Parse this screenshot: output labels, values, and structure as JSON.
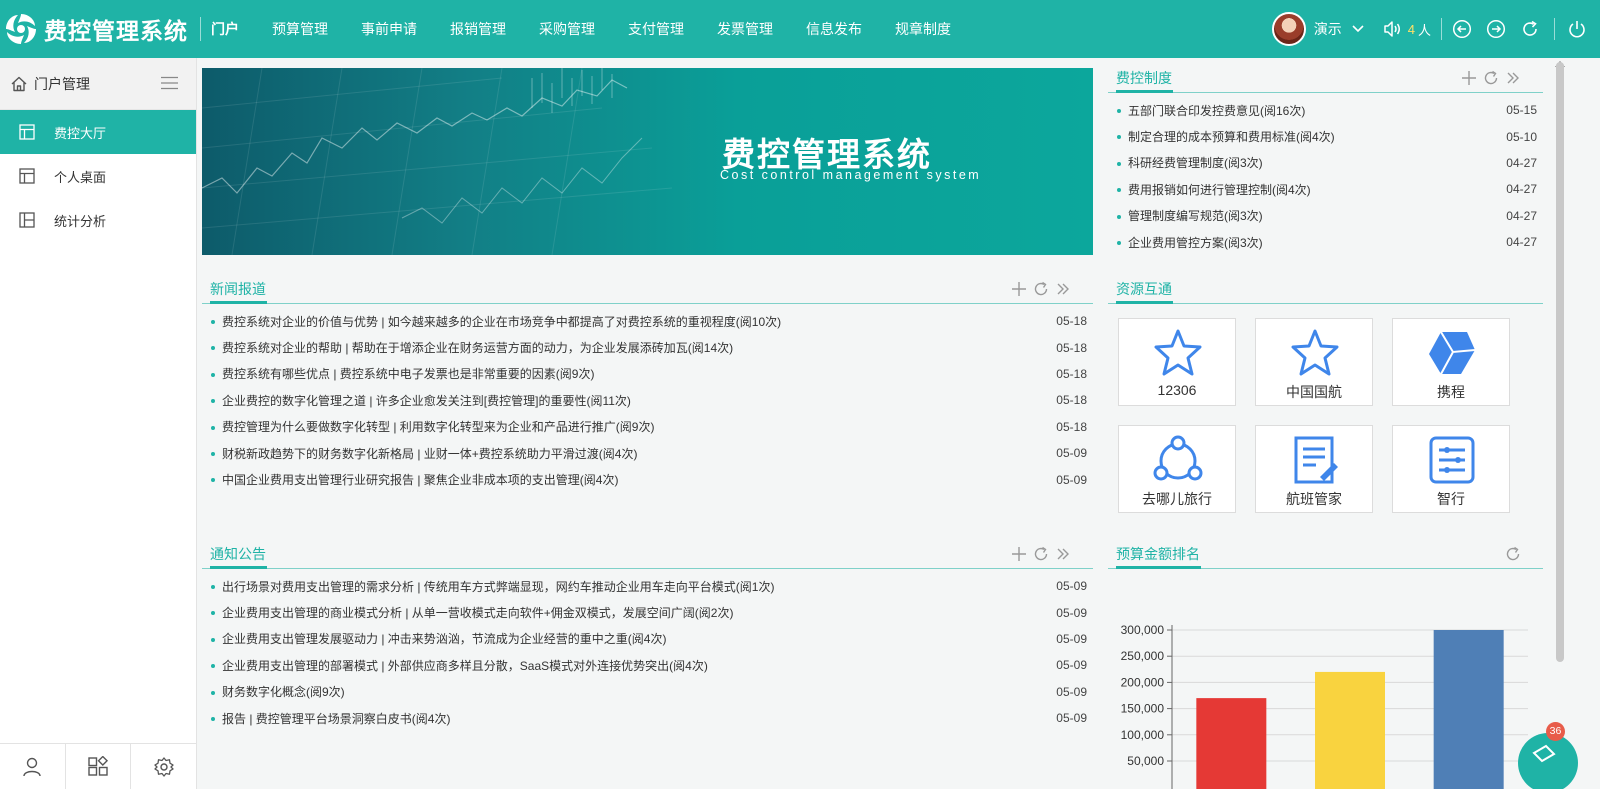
{
  "app": {
    "title": "费控管理系统"
  },
  "topnav": [
    {
      "label": "门户",
      "active": true
    },
    {
      "label": "预算管理"
    },
    {
      "label": "事前申请"
    },
    {
      "label": "报销管理"
    },
    {
      "label": "采购管理"
    },
    {
      "label": "支付管理"
    },
    {
      "label": "发票管理"
    },
    {
      "label": "信息发布"
    },
    {
      "label": "规章制度"
    }
  ],
  "user": {
    "name": "演示",
    "online_count": "4",
    "online_unit": "人"
  },
  "sidebar": {
    "title": "门户管理",
    "items": [
      {
        "label": "费控大厅",
        "active": true
      },
      {
        "label": "个人桌面"
      },
      {
        "label": "统计分析"
      }
    ]
  },
  "banner": {
    "title": "费控管理系统",
    "subtitle": "Cost control management system"
  },
  "news": {
    "title": "新闻报道",
    "items": [
      {
        "text": "费控系统对企业的价值与优势 | 如今越来越多的企业在市场竞争中都提高了对费控系统的重视程度(阅10次)",
        "date": "05-18"
      },
      {
        "text": "费控系统对企业的帮助 | 帮助在于增添企业在财务运营方面的动力，为企业发展添砖加瓦(阅14次)",
        "date": "05-18"
      },
      {
        "text": "费控系统有哪些优点 | 费控系统中电子发票也是非常重要的因素(阅9次)",
        "date": "05-18"
      },
      {
        "text": "企业费控的数字化管理之道 | 许多企业愈发关注到[费控管理]的重要性(阅11次)",
        "date": "05-18"
      },
      {
        "text": "费控管理为什么要做数字化转型 | 利用数字化转型来为企业和产品进行推广(阅9次)",
        "date": "05-18"
      },
      {
        "text": "财税新政趋势下的财务数字化新格局 | 业财一体+费控系统助力平滑过渡(阅4次)",
        "date": "05-09"
      },
      {
        "text": "中国企业费用支出管理行业研究报告 | 聚焦企业非成本项的支出管理(阅4次)",
        "date": "05-09"
      }
    ]
  },
  "notices": {
    "title": "通知公告",
    "items": [
      {
        "text": "出行场景对费用支出管理的需求分析 | 传统用车方式弊端显现，网约车推动企业用车走向平台模式(阅1次)",
        "date": "05-09"
      },
      {
        "text": "企业费用支出管理的商业模式分析 | 从单一营收模式走向软件+佣金双模式，发展空间广阔(阅2次)",
        "date": "05-09"
      },
      {
        "text": "企业费用支出管理发展驱动力 | 冲击来势汹汹，节流成为企业经营的重中之重(阅4次)",
        "date": "05-09"
      },
      {
        "text": "企业费用支出管理的部署模式 | 外部供应商多样且分散，SaaS模式对外连接优势突出(阅4次)",
        "date": "05-09"
      },
      {
        "text": "财务数字化概念(阅9次)",
        "date": "05-09"
      },
      {
        "text": "报告 | 费控管理平台场景洞察白皮书(阅4次)",
        "date": "05-09"
      }
    ]
  },
  "policy": {
    "title": "费控制度",
    "items": [
      {
        "text": "五部门联合印发控费意见(阅16次)",
        "date": "05-15"
      },
      {
        "text": "制定合理的成本预算和费用标准(阅4次)",
        "date": "05-10"
      },
      {
        "text": "科研经费管理制度(阅3次)",
        "date": "04-27"
      },
      {
        "text": "费用报销如何进行管理控制(阅4次)",
        "date": "04-27"
      },
      {
        "text": "管理制度编写规范(阅3次)",
        "date": "04-27"
      },
      {
        "text": "企业费用管控方案(阅3次)",
        "date": "04-27"
      }
    ]
  },
  "resources": {
    "title": "资源互通",
    "items": [
      {
        "label": "12306",
        "icon": "star-icon"
      },
      {
        "label": "中国国航",
        "icon": "star-icon"
      },
      {
        "label": "携程",
        "icon": "box-icon"
      },
      {
        "label": "去哪儿旅行",
        "icon": "share-icon"
      },
      {
        "label": "航班管家",
        "icon": "document-icon"
      },
      {
        "label": "智行",
        "icon": "list-icon"
      }
    ]
  },
  "budget_rank": {
    "title": "预算金额排名"
  },
  "chart_data": {
    "type": "bar",
    "title": "",
    "xlabel": "",
    "ylabel": "",
    "categories": [
      "",
      "",
      ""
    ],
    "values": [
      170000,
      220000,
      300000
    ],
    "ylim": [
      50000,
      300000
    ],
    "yticks": [
      300000,
      250000,
      200000,
      150000,
      100000,
      50000
    ],
    "ytick_labels": [
      "300,000",
      "250,000",
      "200,000",
      "150,000",
      "100,000",
      "50,000"
    ],
    "bar_colors": [
      "#e53935",
      "#f9d33f",
      "#4f7fb6"
    ],
    "grid": true
  },
  "float_badge": {
    "count": "36"
  },
  "colors": {
    "primary": "#1fb3a6",
    "icon_blue": "#3f86ea"
  }
}
